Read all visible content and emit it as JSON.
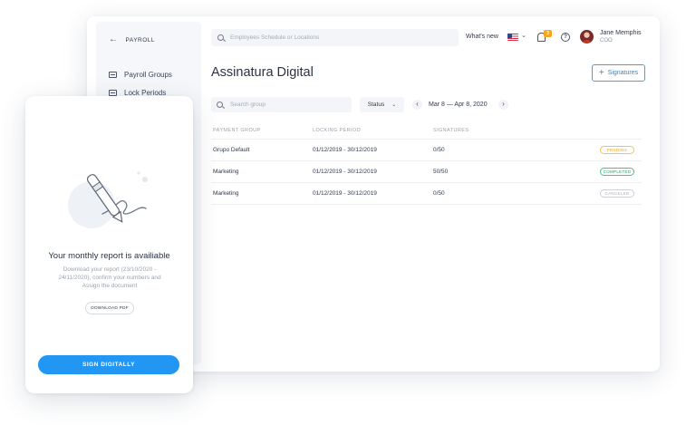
{
  "sidebar": {
    "back_label": "PAYROLL",
    "items": [
      {
        "label": "Payroll Groups",
        "icon": "document-icon"
      },
      {
        "label": "Lock Periods",
        "icon": "document-icon"
      }
    ]
  },
  "header": {
    "search_placeholder": "Employees Schedule or Locations",
    "whats_new": "What's new",
    "notification_count": "3",
    "help_glyph": "?",
    "user": {
      "name": "Jane Memphis",
      "role": "COO"
    }
  },
  "main": {
    "title": "Assinatura Digital",
    "signatures_button": "Signatures",
    "group_search_placeholder": "Search group",
    "status_label": "Status",
    "date_range": "Mar 8 — Apr 8, 2020",
    "table": {
      "columns": [
        "PAYMENT GROUP",
        "LOCKING PERIOD",
        "SIGNATURES"
      ],
      "rows": [
        {
          "group": "Grupo Default",
          "period": "01/12/2019 - 30/12/2019",
          "signatures": "0/50",
          "status": "PENDING"
        },
        {
          "group": "Marketing",
          "period": "01/12/2019 - 30/12/2019",
          "signatures": "50/50",
          "status": "COMPLETED"
        },
        {
          "group": "Marketing",
          "period": "01/12/2019 - 30/12/2019",
          "signatures": "0/50",
          "status": "CANCELED"
        }
      ]
    }
  },
  "card": {
    "title": "Your monthly report is availiable",
    "description": "Download your report (23/10/2020 - 24/11/2020), confirm your numbers and Assign the document",
    "download_button": "DOWNLOAD PDF",
    "sign_button": "SIGN DIGITALLY"
  },
  "colors": {
    "accent": "#2196f3",
    "pending": "#e8a317",
    "completed": "#1ea35f",
    "canceled": "#a7b0bc"
  }
}
